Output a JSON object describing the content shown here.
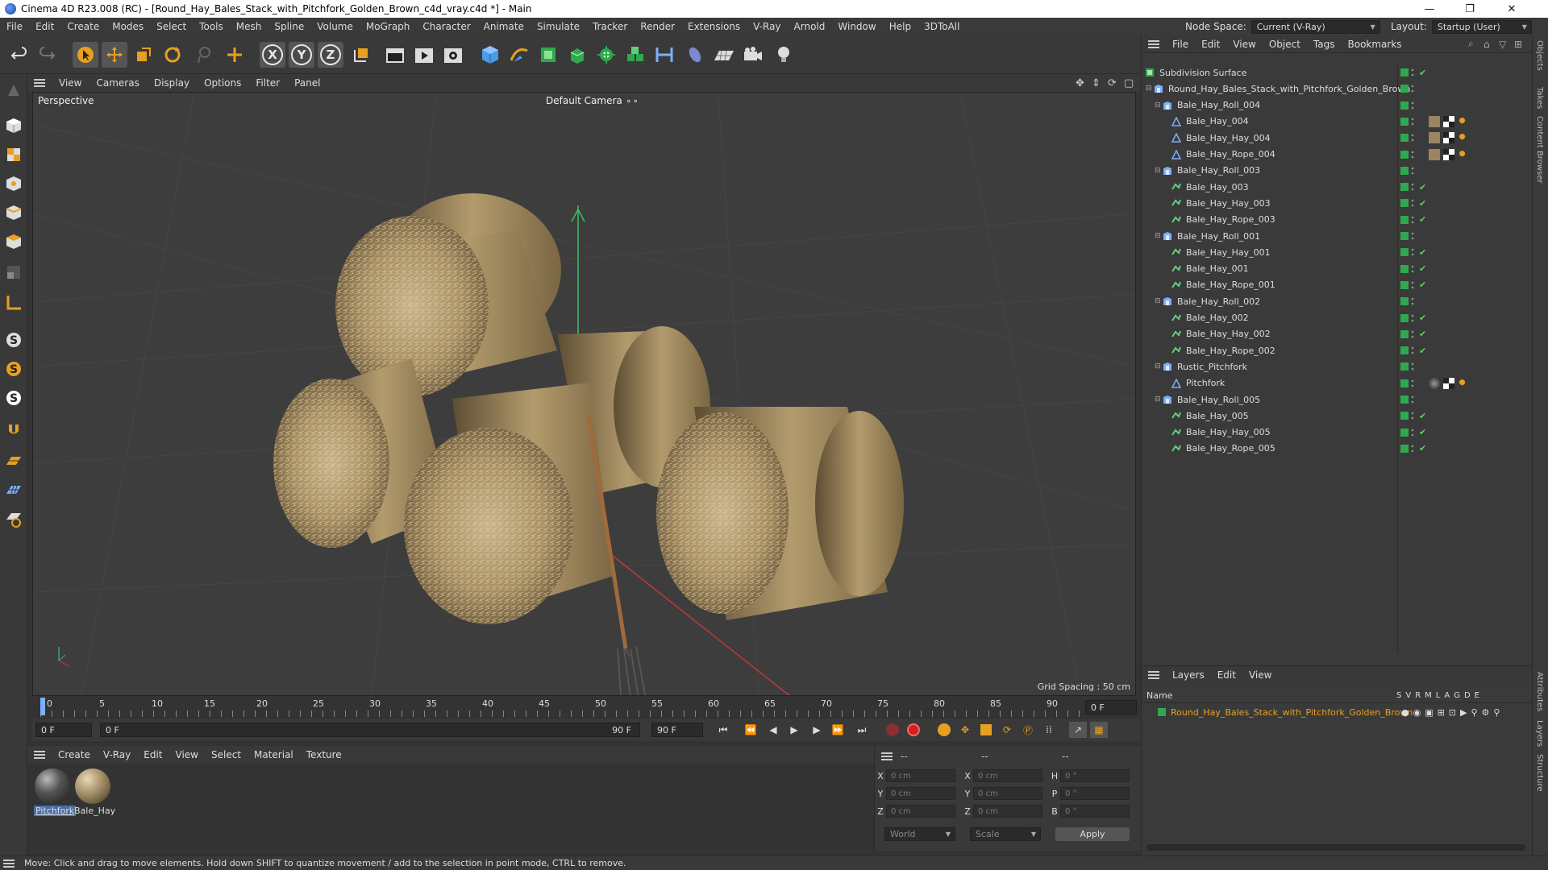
{
  "window": {
    "title": "Cinema 4D R23.008 (RC) - [Round_Hay_Bales_Stack_with_Pitchfork_Golden_Brown_c4d_vray.c4d *] - Main",
    "minimize": "—",
    "maximize": "❐",
    "close": "✕"
  },
  "menubar": {
    "items": [
      "File",
      "Edit",
      "Create",
      "Modes",
      "Select",
      "Tools",
      "Mesh",
      "Spline",
      "Volume",
      "MoGraph",
      "Character",
      "Animate",
      "Simulate",
      "Tracker",
      "Render",
      "Extensions",
      "V-Ray",
      "Arnold",
      "Window",
      "Help",
      "3DToAll"
    ],
    "node_space_label": "Node Space:",
    "node_space_value": "Current (V-Ray)",
    "layout_label": "Layout:",
    "layout_value": "Startup (User)"
  },
  "toolbar": {
    "axis_x": "X",
    "axis_y": "Y",
    "axis_z": "Z"
  },
  "viewport": {
    "menu": [
      "View",
      "Cameras",
      "Display",
      "Options",
      "Filter",
      "Panel"
    ],
    "name": "Perspective",
    "camera": "Default Camera",
    "grid_spacing": "Grid Spacing : 50 cm"
  },
  "timeline": {
    "ticks": [
      "0",
      "5",
      "10",
      "15",
      "20",
      "25",
      "30",
      "35",
      "40",
      "45",
      "50",
      "55",
      "60",
      "65",
      "70",
      "75",
      "80",
      "85",
      "90"
    ],
    "current_frame": "0 F",
    "start_field": "0 F",
    "range_start": "0 F",
    "range_end": "90 F",
    "end_field": "90 F"
  },
  "materials": {
    "menu": [
      "Create",
      "V-Ray",
      "Edit",
      "View",
      "Select",
      "Material",
      "Texture"
    ],
    "items": [
      {
        "name": "Pitchfork",
        "selected": true
      },
      {
        "name": "Bale_Hay",
        "selected": false
      }
    ]
  },
  "coordinates": {
    "header": [
      "--",
      "--",
      "--"
    ],
    "rows": [
      {
        "a": "X",
        "av": "0 cm",
        "b": "X",
        "bv": "0 cm",
        "c": "H",
        "cv": "0 °"
      },
      {
        "a": "Y",
        "av": "0 cm",
        "b": "Y",
        "bv": "0 cm",
        "c": "P",
        "cv": "0 °"
      },
      {
        "a": "Z",
        "av": "0 cm",
        "b": "Z",
        "bv": "0 cm",
        "c": "B",
        "cv": "0 °"
      }
    ],
    "mode": "World",
    "scale": "Scale",
    "apply": "Apply"
  },
  "status": "Move: Click and drag to move elements. Hold down SHIFT to quantize movement / add to the selection in point mode, CTRL to remove.",
  "objects": {
    "menu": [
      "File",
      "Edit",
      "View",
      "Object",
      "Tags",
      "Bookmarks"
    ],
    "rows": [
      {
        "name": "Subdivision Surface",
        "indent": 0,
        "kind": "subdiv",
        "tag": "check"
      },
      {
        "name": "Round_Hay_Bales_Stack_with_Pitchfork_Golden_Brown",
        "indent": 1,
        "kind": "null",
        "tag": "none"
      },
      {
        "name": "Bale_Hay_Roll_004",
        "indent": 2,
        "kind": "null",
        "tag": "none"
      },
      {
        "name": "Bale_Hay_004",
        "indent": 3,
        "kind": "mesh",
        "tag": "mat"
      },
      {
        "name": "Bale_Hay_Hay_004",
        "indent": 3,
        "kind": "mesh",
        "tag": "mat"
      },
      {
        "name": "Bale_Hay_Rope_004",
        "indent": 3,
        "kind": "mesh",
        "tag": "mat"
      },
      {
        "name": "Bale_Hay_Roll_003",
        "indent": 2,
        "kind": "null",
        "tag": "none"
      },
      {
        "name": "Bale_Hay_003",
        "indent": 3,
        "kind": "poly",
        "tag": "check"
      },
      {
        "name": "Bale_Hay_Hay_003",
        "indent": 3,
        "kind": "poly",
        "tag": "check"
      },
      {
        "name": "Bale_Hay_Rope_003",
        "indent": 3,
        "kind": "poly",
        "tag": "check"
      },
      {
        "name": "Bale_Hay_Roll_001",
        "indent": 2,
        "kind": "null",
        "tag": "none"
      },
      {
        "name": "Bale_Hay_Hay_001",
        "indent": 3,
        "kind": "poly",
        "tag": "check"
      },
      {
        "name": "Bale_Hay_001",
        "indent": 3,
        "kind": "poly",
        "tag": "check"
      },
      {
        "name": "Bale_Hay_Rope_001",
        "indent": 3,
        "kind": "poly",
        "tag": "check"
      },
      {
        "name": "Bale_Hay_Roll_002",
        "indent": 2,
        "kind": "null",
        "tag": "none"
      },
      {
        "name": "Bale_Hay_002",
        "indent": 3,
        "kind": "poly",
        "tag": "check"
      },
      {
        "name": "Bale_Hay_Hay_002",
        "indent": 3,
        "kind": "poly",
        "tag": "check"
      },
      {
        "name": "Bale_Hay_Rope_002",
        "indent": 3,
        "kind": "poly",
        "tag": "check"
      },
      {
        "name": "Rustic_Pitchfork",
        "indent": 2,
        "kind": "null",
        "tag": "none"
      },
      {
        "name": "Pitchfork",
        "indent": 3,
        "kind": "mesh",
        "tag": "mat2"
      },
      {
        "name": "Bale_Hay_Roll_005",
        "indent": 2,
        "kind": "null",
        "tag": "none"
      },
      {
        "name": "Bale_Hay_005",
        "indent": 3,
        "kind": "poly",
        "tag": "check"
      },
      {
        "name": "Bale_Hay_Hay_005",
        "indent": 3,
        "kind": "poly",
        "tag": "check"
      },
      {
        "name": "Bale_Hay_Rope_005",
        "indent": 3,
        "kind": "poly",
        "tag": "check"
      }
    ]
  },
  "layers": {
    "menu": [
      "Layers",
      "Edit",
      "View"
    ],
    "col_name": "Name",
    "cols": [
      "S",
      "V",
      "R",
      "M",
      "L",
      "A",
      "G",
      "D",
      "E"
    ],
    "row": "Round_Hay_Bales_Stack_with_Pitchfork_Golden_Brown",
    "color": "#2fa84f"
  },
  "sidetabs": [
    "Objects",
    "Takes",
    "Content Browser",
    "Attributes",
    "Layers",
    "Structure"
  ],
  "colors": {
    "accent": "#2fa84f",
    "check": "#56d35b",
    "orange": "#e8a020",
    "layer_text": "#e8a020"
  }
}
